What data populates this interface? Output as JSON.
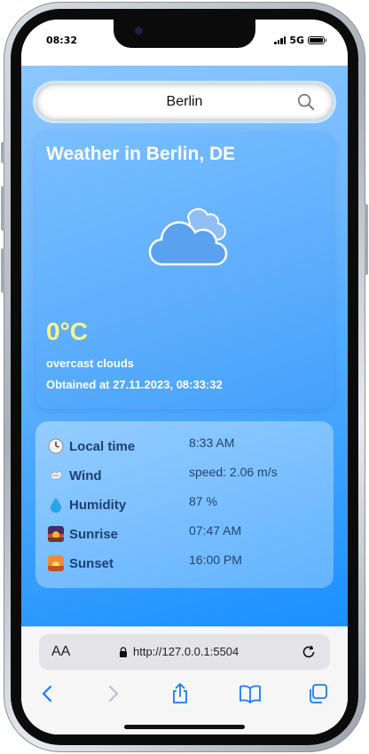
{
  "status_bar": {
    "time": "08:32",
    "network": "5G"
  },
  "search": {
    "value": "Berlin"
  },
  "weather": {
    "title": "Weather in Berlin, DE",
    "temperature": "0°C",
    "description": "overcast clouds",
    "obtained": "Obtained at 27.11.2023, 08:33:32",
    "icon": "cloud-icon"
  },
  "details": [
    {
      "icon": "clock-icon",
      "label": "Local time",
      "value": "8:33 AM"
    },
    {
      "icon": "wind-icon",
      "label": "Wind",
      "value": "speed: 2.06 m/s"
    },
    {
      "icon": "droplet-icon",
      "label": "Humidity",
      "value": "87 %"
    },
    {
      "icon": "sunrise-icon",
      "label": "Sunrise",
      "value": "07:47 AM"
    },
    {
      "icon": "sunset-icon",
      "label": "Sunset",
      "value": "16:00 PM"
    }
  ],
  "browser": {
    "text_size": "AA",
    "url": "http://127.0.0.1:5504"
  },
  "colors": {
    "accent": "#1a8cff",
    "temperature": "#fff585",
    "label": "#1e3f73"
  }
}
